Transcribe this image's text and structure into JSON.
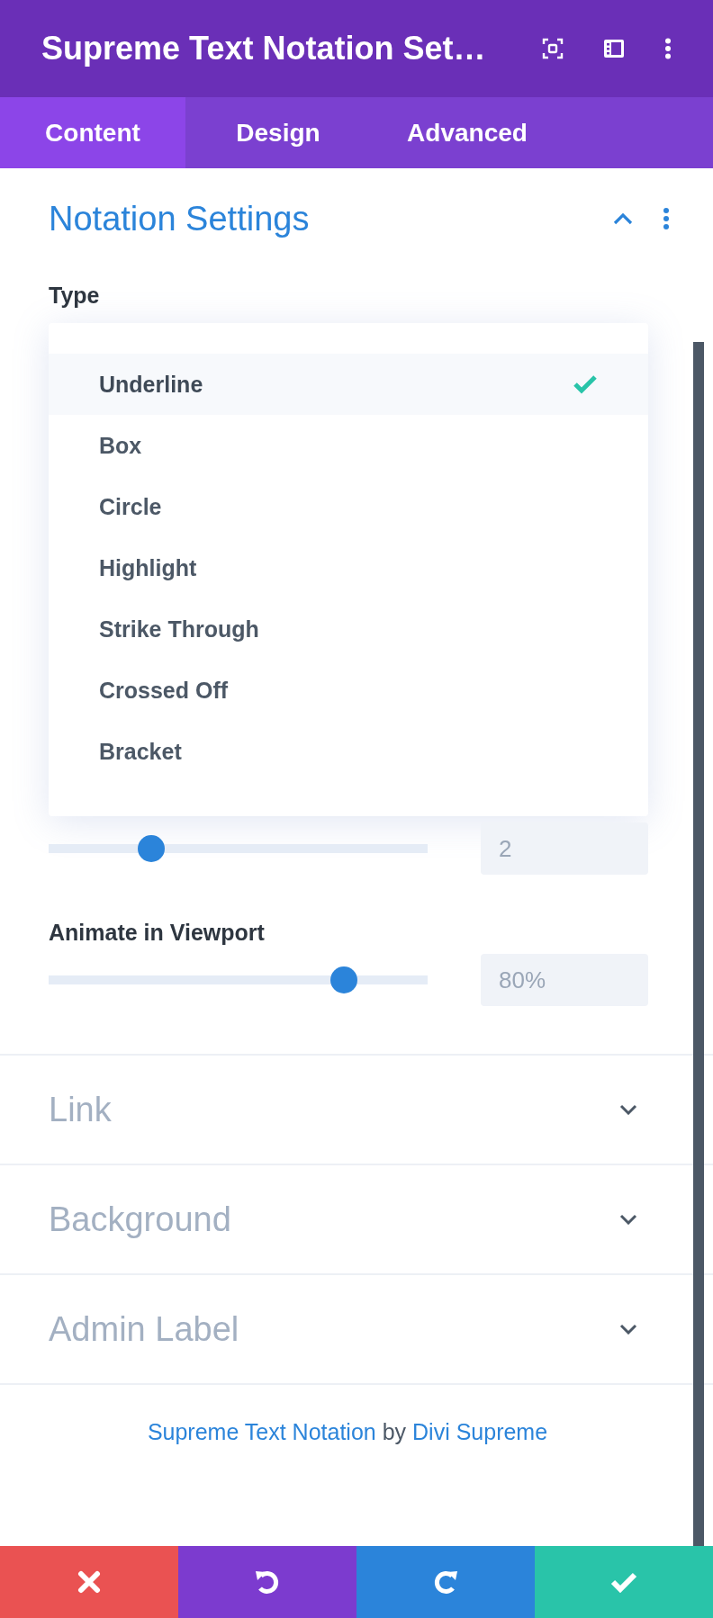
{
  "header": {
    "title": "Supreme Text Notation Set…",
    "icons": [
      {
        "kind": "expand"
      },
      {
        "kind": "split"
      },
      {
        "kind": "more"
      }
    ]
  },
  "tabs": [
    {
      "label": "Content",
      "selected": true
    },
    {
      "label": "Design",
      "selected": false
    },
    {
      "label": "Advanced",
      "selected": false
    }
  ],
  "section": {
    "title": "Notation Settings",
    "expanded": true,
    "type_field": {
      "label": "Type",
      "options": [
        {
          "label": "Underline",
          "selected": true
        },
        {
          "label": "Box",
          "selected": false
        },
        {
          "label": "Circle",
          "selected": false
        },
        {
          "label": "Highlight",
          "selected": false
        },
        {
          "label": "Strike Through",
          "selected": false
        },
        {
          "label": "Crossed Off",
          "selected": false
        },
        {
          "label": "Bracket",
          "selected": false
        }
      ]
    },
    "sliders": [
      {
        "level": 0.27,
        "value": "2"
      },
      {
        "label": "Animate in Viewport",
        "level": 0.78,
        "value": "80%"
      }
    ]
  },
  "collapsed_sections": [
    {
      "title": "Link",
      "expanded": false
    },
    {
      "title": "Background",
      "expanded": false
    },
    {
      "title": "Admin Label",
      "expanded": false
    }
  ],
  "footer": {
    "product_link": "Supreme Text Notation",
    "by": "by",
    "author_link": "Divi Supreme"
  },
  "action_bar": [
    {
      "kind": "discard"
    },
    {
      "kind": "undo"
    },
    {
      "kind": "redo"
    },
    {
      "kind": "save"
    }
  ]
}
